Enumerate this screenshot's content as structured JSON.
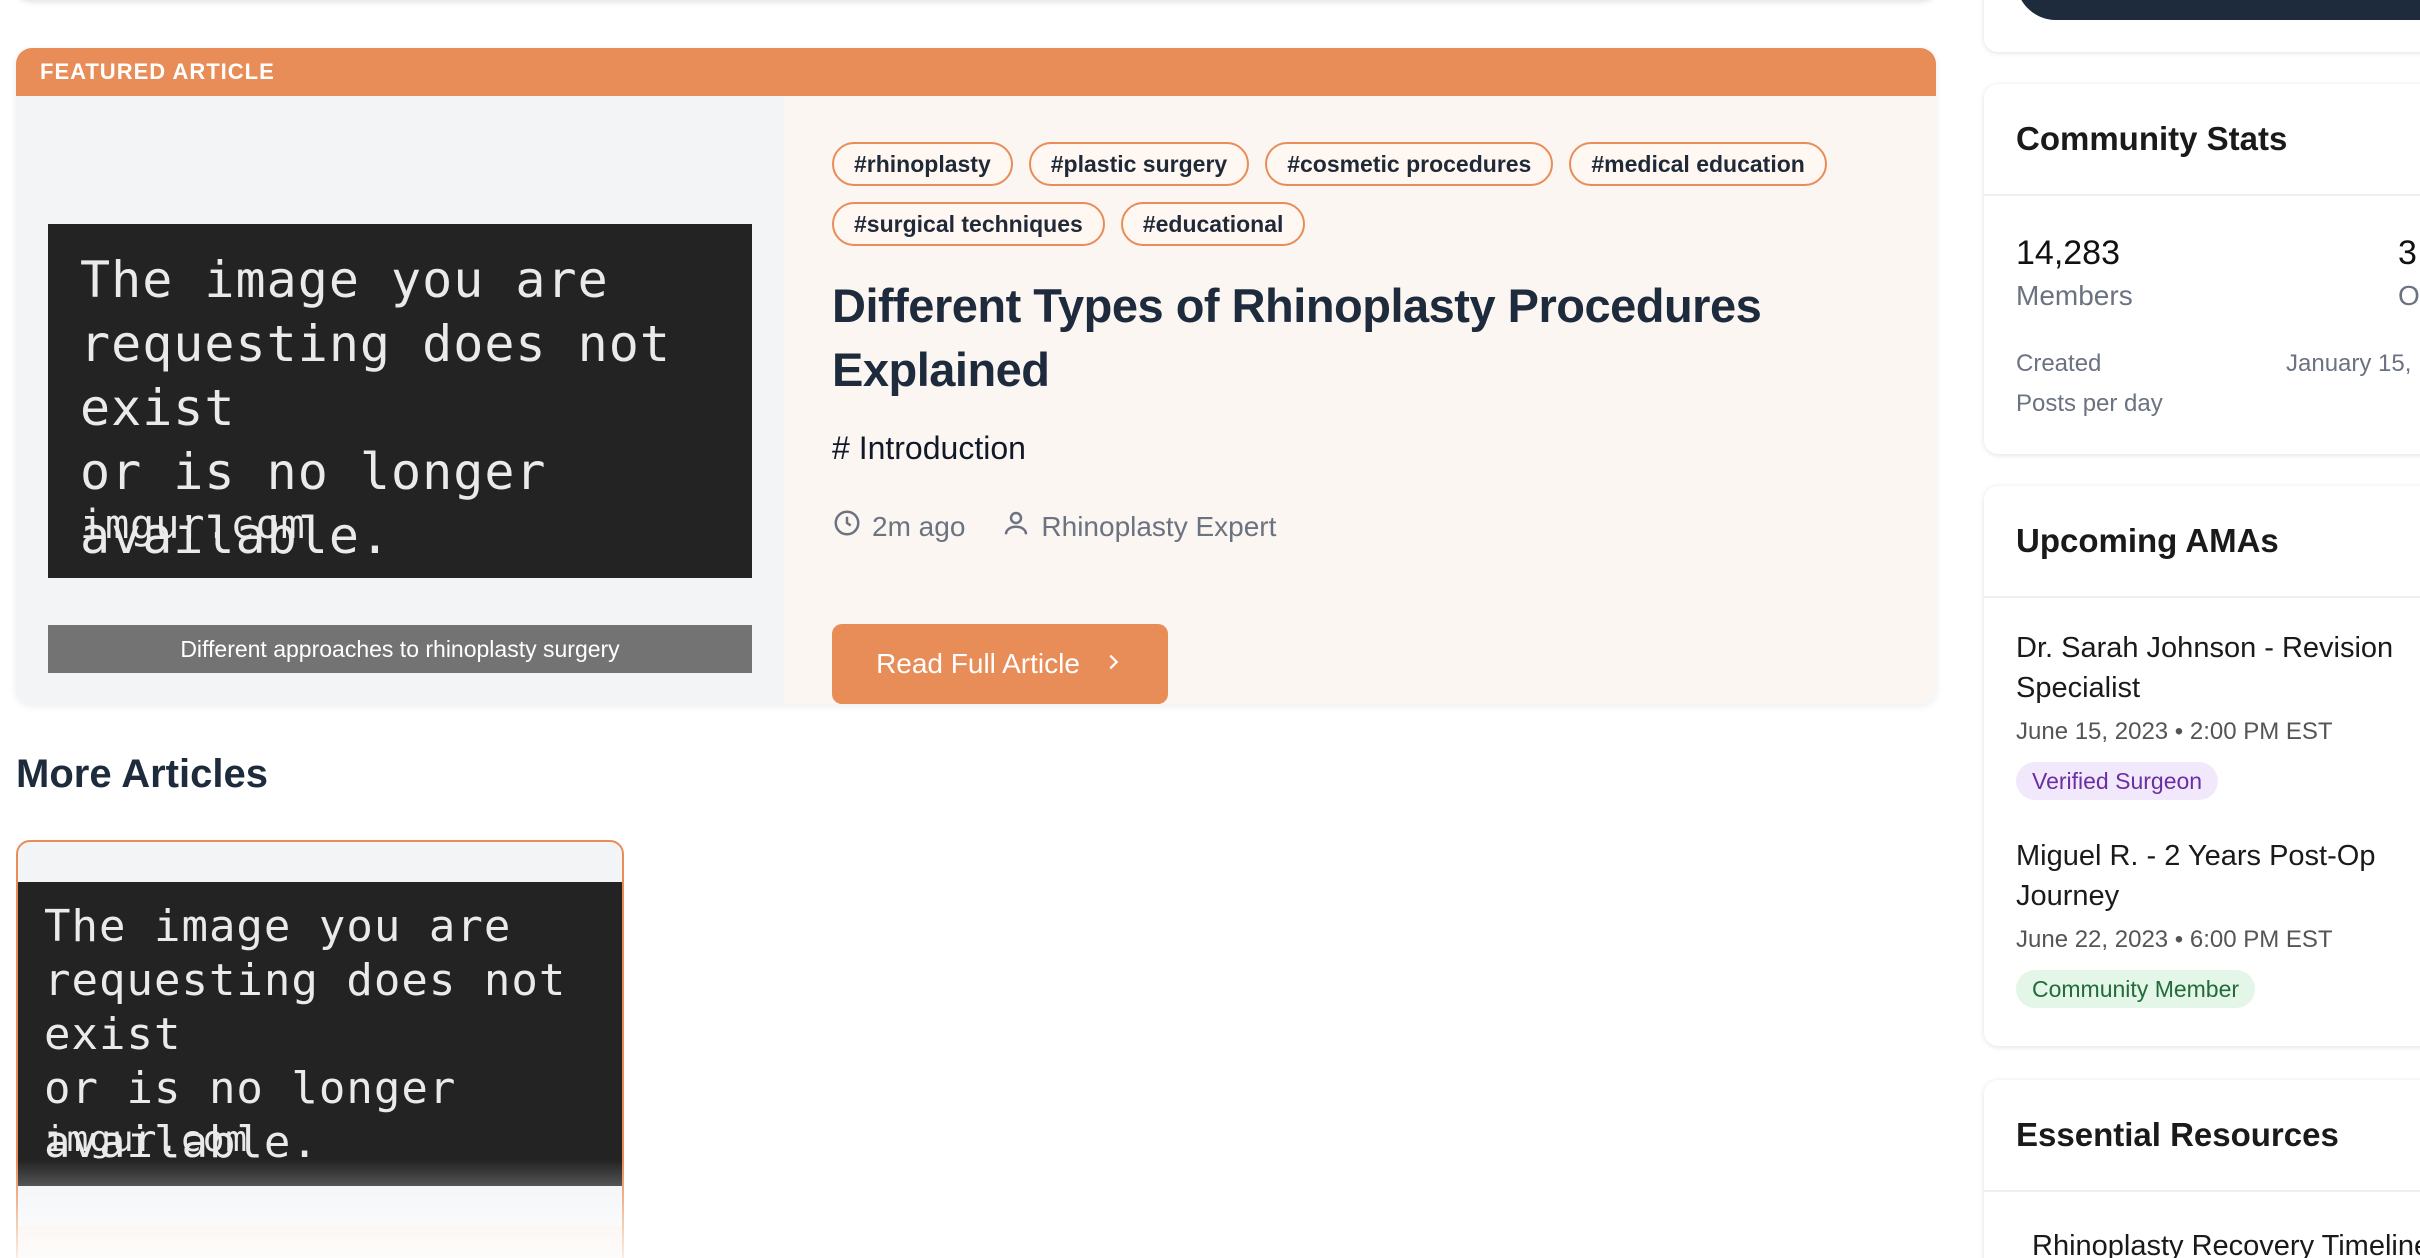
{
  "featured": {
    "banner": "FEATURED ARTICLE",
    "tags": [
      "#rhinoplasty",
      "#plastic surgery",
      "#cosmetic procedures",
      "#medical education",
      "#surgical techniques",
      "#educational"
    ],
    "title": "Different Types of Rhinoplasty Procedures Explained",
    "excerpt": "# Introduction",
    "time": "2m ago",
    "author": "Rhinoplasty Expert",
    "read_button": "Read Full Article",
    "image": {
      "message": "The image you are\nrequesting does not exist\nor is no longer available.",
      "site": "imgur.com"
    },
    "caption": "Different approaches to rhinoplasty surgery"
  },
  "more_articles": {
    "title": "More Articles",
    "card_image": {
      "message": "The image you are\nrequesting does not exist\nor is no longer available.",
      "site": "imgur.com"
    }
  },
  "sidebar": {
    "stats": {
      "title": "Community Stats",
      "members_value": "14,283",
      "members_label": "Members",
      "online_value": "3",
      "online_label": "O",
      "created_label": "Created",
      "created_value": "January 15,",
      "posts_label": "Posts per day"
    },
    "amas": {
      "title": "Upcoming AMAs",
      "items": [
        {
          "name": "Dr. Sarah Johnson - Revision Specialist",
          "date": "June 15, 2023 • 2:00 PM EST",
          "badge": "Verified Surgeon"
        },
        {
          "name": "Miguel R. - 2 Years Post-Op Journey",
          "date": "June 22, 2023 • 6:00 PM EST",
          "badge": "Community Member"
        }
      ]
    },
    "resources": {
      "title": "Essential Resources",
      "items": [
        "Rhinoplasty Recovery Timeline"
      ]
    }
  },
  "colors": {
    "accent": "#e88c58",
    "heading": "#1e2b3c",
    "verified_bg": "#f1e8fb",
    "community_bg": "#e3f6e8"
  },
  "icons": {
    "time": "clock-icon",
    "author": "user-icon",
    "button": "chevron-right-icon"
  }
}
